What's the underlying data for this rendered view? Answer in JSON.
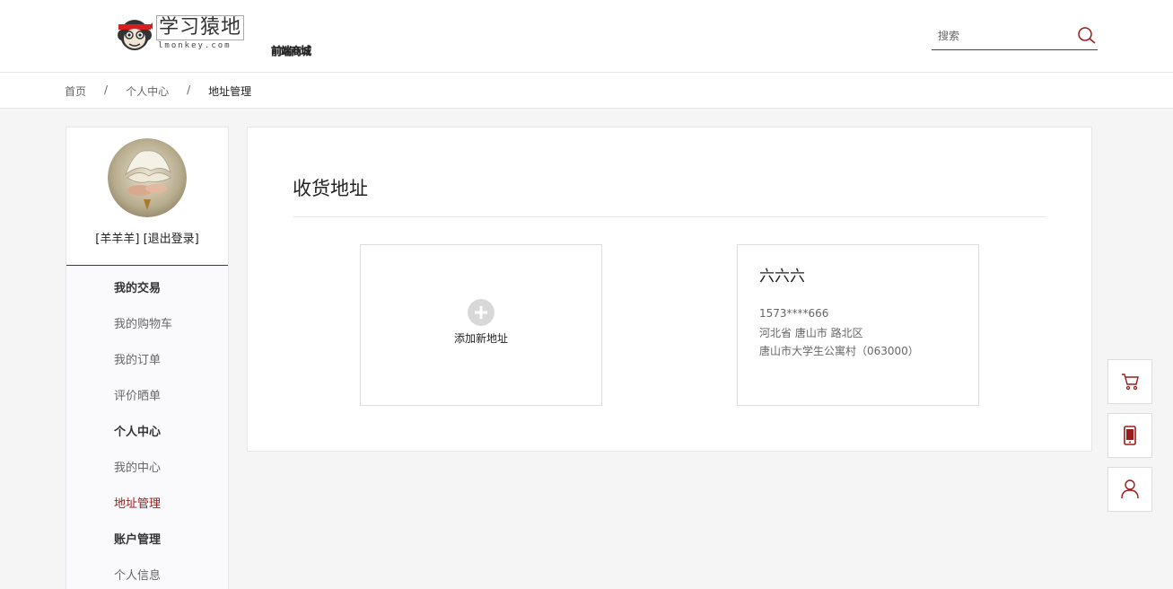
{
  "header": {
    "logo_title": "学习猿地",
    "logo_sub": "lmonkey.com",
    "logo_tag": "前端商城",
    "search": {
      "placeholder": "搜索"
    }
  },
  "breadcrumb": {
    "items": [
      "首页",
      "个人中心",
      "地址管理"
    ],
    "separator": "/"
  },
  "sidebar": {
    "username": "[羊羊羊]",
    "logout": "[退出登录]",
    "menu": [
      {
        "label": "我的交易",
        "type": "heading"
      },
      {
        "label": "我的购物车",
        "type": "link"
      },
      {
        "label": "我的订单",
        "type": "link"
      },
      {
        "label": "评价晒单",
        "type": "link"
      },
      {
        "label": "个人中心",
        "type": "heading"
      },
      {
        "label": "我的中心",
        "type": "link"
      },
      {
        "label": "地址管理",
        "type": "active"
      },
      {
        "label": "账户管理",
        "type": "heading"
      },
      {
        "label": "个人信息",
        "type": "link"
      }
    ]
  },
  "main": {
    "title": "收货地址",
    "add_label": "添加新地址",
    "address": {
      "name": "六六六",
      "phone": "1573****666",
      "region": "河北省 唐山市 路北区",
      "detail": "唐山市大学生公寓村（063000）"
    }
  },
  "floating": {
    "icons": [
      "cart-icon",
      "phone-icon",
      "user-icon"
    ]
  },
  "colors": {
    "accent": "#9b1b1b",
    "background": "#f5f5f5",
    "border": "#e6e6e6"
  }
}
